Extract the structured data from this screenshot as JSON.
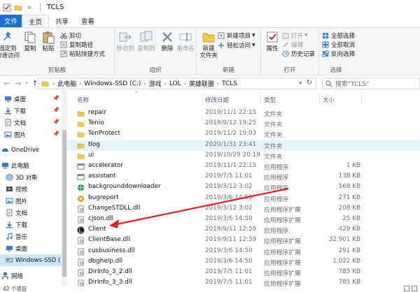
{
  "window": {
    "title": "TCLS",
    "status": "42 个项目"
  },
  "tabs": [
    {
      "label": "文件"
    },
    {
      "label": "主页"
    },
    {
      "label": "共享"
    },
    {
      "label": "查看"
    }
  ],
  "ribbon": {
    "clipboard": {
      "group_label": "剪贴板",
      "pin_label": "固定到\n快速访问",
      "copy_label": "复制",
      "paste_label": "粘贴",
      "cut_label": "剪切",
      "copy_path_label": "复制路径",
      "paste_shortcut_label": "粘贴快捷方式"
    },
    "organize": {
      "group_label": "组织",
      "move_to_label": "移动到",
      "copy_to_label": "复制到",
      "delete_label": "删除",
      "rename_label": "重命名"
    },
    "new": {
      "group_label": "新建",
      "new_folder_label": "新建\n文件夹",
      "new_item_label": "新建项目",
      "easy_access_label": "轻松访问"
    },
    "open": {
      "group_label": "打开",
      "properties_label": "属性",
      "open_label": "打开",
      "edit_label": "编辑",
      "history_label": "历史记录"
    },
    "select": {
      "group_label": "选择",
      "select_all_label": "全部选择",
      "select_none_label": "全部取消",
      "invert_label": "反向选择"
    }
  },
  "address": {
    "crumbs": [
      "此电脑",
      "Windows-SSD (C:)",
      "游戏",
      "LOL",
      "英雄联盟",
      "TCLS"
    ],
    "search_placeholder": "搜索\"TCLS\""
  },
  "nav": [
    {
      "label": "桌面",
      "icon": "desktop-icon",
      "pinned": true
    },
    {
      "label": "下载",
      "icon": "download-icon",
      "pinned": true
    },
    {
      "label": "文档",
      "icon": "document-icon",
      "pinned": true
    },
    {
      "label": "图片",
      "icon": "picture-icon",
      "pinned": true
    },
    {
      "label": "OneDrive",
      "icon": "cloud-icon",
      "pinned": false
    },
    {
      "label": "此电脑",
      "icon": "computer-icon",
      "pinned": false
    },
    {
      "label": "3D 对象",
      "icon": "cube-icon",
      "pinned": false
    },
    {
      "label": "视频",
      "icon": "video-icon",
      "pinned": false
    },
    {
      "label": "图片",
      "icon": "picture-icon",
      "pinned": false
    },
    {
      "label": "文档",
      "icon": "document-icon",
      "pinned": false
    },
    {
      "label": "下载",
      "icon": "download-icon",
      "pinned": false
    },
    {
      "label": "音乐",
      "icon": "music-icon",
      "pinned": false
    },
    {
      "label": "桌面",
      "icon": "desktop-icon",
      "pinned": false
    },
    {
      "label": "Windows-SSD (",
      "icon": "drive-icon",
      "pinned": false
    },
    {
      "label": "网络",
      "icon": "network-icon",
      "pinned": false
    }
  ],
  "columns": {
    "name": "名称",
    "date": "修改日期",
    "type": "类型",
    "size": "大小"
  },
  "files": [
    {
      "name": "repair",
      "date": "2019/11/1 22:15",
      "type": "文件夹",
      "size": "",
      "icon": "folder-icon"
    },
    {
      "name": "Tenio",
      "date": "2019/9/12 19:25",
      "type": "文件夹",
      "size": "",
      "icon": "folder-icon"
    },
    {
      "name": "TenProtect",
      "date": "2019/11/2 19:03",
      "type": "文件夹",
      "size": "",
      "icon": "folder-icon"
    },
    {
      "name": "tlog",
      "date": "2020/1/31 23:41",
      "type": "文件夹",
      "size": "",
      "icon": "folder-icon"
    },
    {
      "name": "ui",
      "date": "2019/10/29 20:19",
      "type": "文件夹",
      "size": "",
      "icon": "folder-icon"
    },
    {
      "name": "accelerator",
      "date": "2019/11/1 22:15",
      "type": "应用程序",
      "size": "1 KB",
      "icon": "app-icon"
    },
    {
      "name": "assistant",
      "date": "2019/7/5 11:01",
      "type": "应用程序",
      "size": "138 KB",
      "icon": "app-icon"
    },
    {
      "name": "backgrounddownloader",
      "date": "2019/3/12 3:02",
      "type": "应用程序",
      "size": "568 KB",
      "icon": "globe-icon"
    },
    {
      "name": "bugreport",
      "date": "2019/3/6 14:50",
      "type": "应用程序",
      "size": "271 KB",
      "icon": "bug-icon"
    },
    {
      "name": "ChangeSTDLL.dll",
      "date": "2019/3/12 3:02",
      "type": "应用程序扩展",
      "size": "208 KB",
      "icon": "dll-icon"
    },
    {
      "name": "cjson.dll",
      "date": "2019/3/6 14:50",
      "type": "应用程序扩展",
      "size": "25 KB",
      "icon": "dll-icon"
    },
    {
      "name": "Client",
      "date": "2019/9/11 12:59",
      "type": "应用程序",
      "size": "429 KB",
      "icon": "lol-client-icon"
    },
    {
      "name": "ClientBase.dll",
      "date": "2019/9/11 12:59",
      "type": "应用程序扩展",
      "size": "32,901 KB",
      "icon": "dll-icon"
    },
    {
      "name": "cusbusiness.dll",
      "date": "2019/3/6 14:50",
      "type": "应用程序扩展",
      "size": "291 KB",
      "icon": "dll-icon"
    },
    {
      "name": "dbghelp.dll",
      "date": "2019/3/6 14:50",
      "type": "应用程序扩展",
      "size": "1,022 KB",
      "icon": "dll-icon"
    },
    {
      "name": "DirInfo_3_2.dll",
      "date": "2019/7/5 11:01",
      "type": "应用程序扩展",
      "size": "785 KB",
      "icon": "dll-icon"
    },
    {
      "name": "DirInfo_3_3.dll",
      "date": "2019/7/5 11:01",
      "type": "应用程序扩展",
      "size": "785 KB",
      "icon": "dll-icon"
    }
  ],
  "colors": {
    "file_tab": "#1a6fd0",
    "selection": "#cce8ff",
    "hover": "#e5f3ff",
    "folder": "#f2c94c",
    "annotation_arrow": "#e02020"
  }
}
